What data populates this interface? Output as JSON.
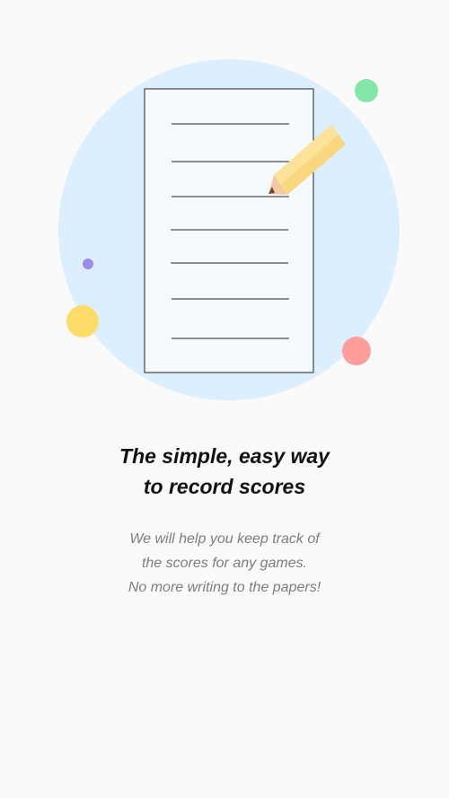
{
  "onboarding": {
    "illustration_icon": "notepad-with-pencil-icon",
    "title_lines": [
      "The simple, easy way",
      "to record scores"
    ],
    "subtitle_lines": [
      "We will help you keep track of",
      "the scores for any games.",
      "No more writing to the papers!"
    ]
  },
  "colors": {
    "background": "#fafafa",
    "circle": "#dcefff",
    "paper": "#f5faff",
    "pencil_body": "#f9d77e",
    "dot_green": "#84e5a8",
    "dot_purple": "#9f8be6",
    "dot_yellow": "#fddc6a",
    "dot_red": "#ff9d9d"
  }
}
